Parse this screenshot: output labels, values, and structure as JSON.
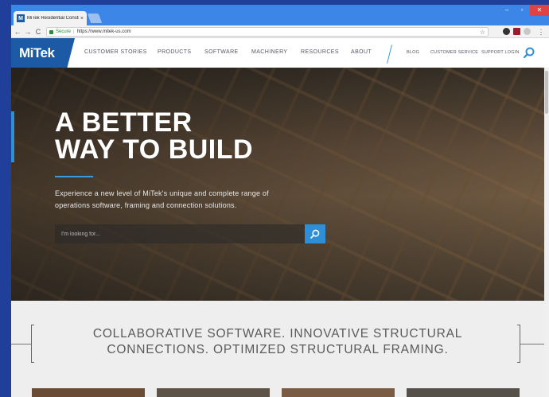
{
  "browser": {
    "tab_title": "MiTek Residential Constr",
    "tab_close": "×",
    "tab_favicon": "M",
    "window_controls": {
      "minimize": "–",
      "maximize": "▫",
      "close": "✕"
    },
    "back": "←",
    "forward": "→",
    "reload": "C",
    "secure_label": "Secure",
    "url_separator": "|",
    "url": "https://www.mitek-us.com",
    "star": "☆",
    "menu": "⋮"
  },
  "site": {
    "logo": "MiTek",
    "nav": [
      "CUSTOMER STORIES",
      "PRODUCTS",
      "SOFTWARE",
      "MACHINERY",
      "RESOURCES",
      "ABOUT"
    ],
    "utility_nav": [
      "BLOG",
      "CUSTOMER SERVICE",
      "SUPPORT LOGIN"
    ]
  },
  "hero": {
    "title_line1": "A BETTER",
    "title_line2": "WAY TO BUILD",
    "text": "Experience a new level of MiTek's unique and complete range of operations software, framing and connection solutions.",
    "search_placeholder": "I'm looking for..."
  },
  "tagline": {
    "line1": "COLLABORATIVE SOFTWARE. INNOVATIVE STRUCTURAL",
    "line2": "CONNECTIONS. OPTIMIZED STRUCTURAL FRAMING."
  },
  "colors": {
    "brand_blue": "#1c5aa6",
    "accent_blue": "#2f8fd6",
    "chrome_blue": "#3c86e8"
  }
}
